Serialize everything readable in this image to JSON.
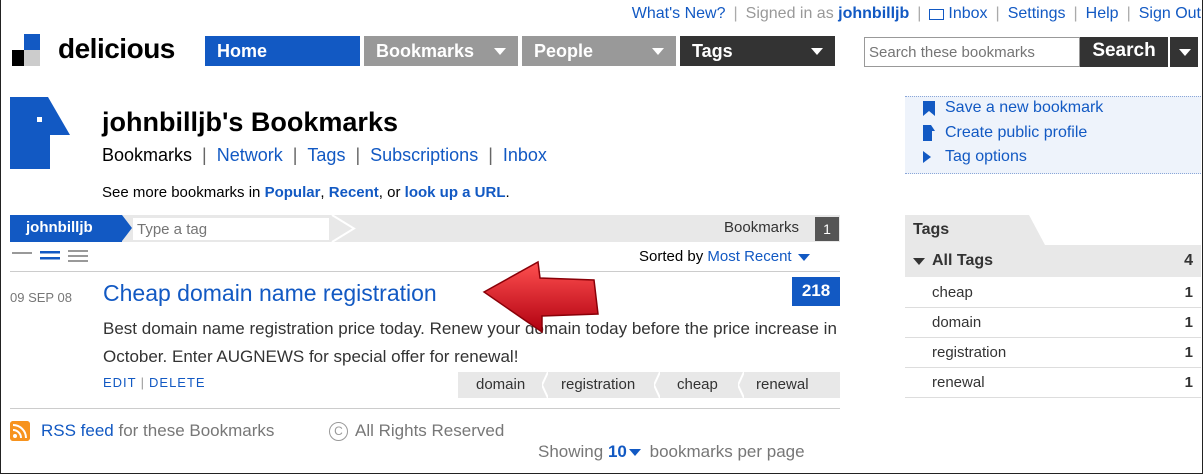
{
  "header": {
    "whats_new": "What's New?",
    "signed_in_prefix": "Signed in as",
    "username": "johnbilljb",
    "inbox": "Inbox",
    "settings": "Settings",
    "help": "Help",
    "sign_out": "Sign Out"
  },
  "logo": {
    "text": "delicious"
  },
  "nav": {
    "home": "Home",
    "bookmarks": "Bookmarks",
    "people": "People",
    "tags": "Tags"
  },
  "search": {
    "placeholder": "Search these bookmarks",
    "button": "Search"
  },
  "profile": {
    "title": "johnbilljb's Bookmarks",
    "subnav": [
      "Bookmarks",
      "Network",
      "Tags",
      "Subscriptions",
      "Inbox"
    ],
    "see_more_prefix": "See more bookmarks in",
    "popular": "Popular",
    "recent": "Recent",
    "or": ", or",
    "lookup": "look up a URL",
    "suffix": "."
  },
  "tagbar": {
    "user": "johnbilljb",
    "placeholder": "Type a tag",
    "bookmarks_label": "Bookmarks",
    "bookmarks_count": "1"
  },
  "sort": {
    "label": "Sorted by",
    "value": "Most Recent"
  },
  "bookmark": {
    "date": "09 SEP 08",
    "title": "Cheap domain name registration",
    "saves": "218",
    "description": "Best domain name registration price today. Renew your domain today before the price increase in October. Enter AUGNEWS for special offer for renewal!",
    "edit": "EDIT",
    "delete": "DELETE",
    "tags": [
      "domain",
      "registration",
      "cheap",
      "renewal"
    ]
  },
  "footer": {
    "rss_link": "RSS feed",
    "rss_suffix": "for these Bookmarks",
    "copyright": "All Rights Reserved",
    "showing_prefix": "Showing",
    "showing_num": "10",
    "showing_suffix": "bookmarks per page"
  },
  "sidebar": {
    "actions": [
      "Save a new bookmark",
      "Create public profile",
      "Tag options"
    ],
    "tags_tab": "Tags",
    "all_tags_label": "All Tags",
    "all_tags_count": "4",
    "tags": [
      {
        "name": "cheap",
        "count": "1"
      },
      {
        "name": "domain",
        "count": "1"
      },
      {
        "name": "registration",
        "count": "1"
      },
      {
        "name": "renewal",
        "count": "1"
      }
    ]
  },
  "colors": {
    "accent_blue": "#1259c3",
    "nav_gray": "#999999",
    "nav_dark": "#333333",
    "arrow_red": "#d4141c"
  }
}
